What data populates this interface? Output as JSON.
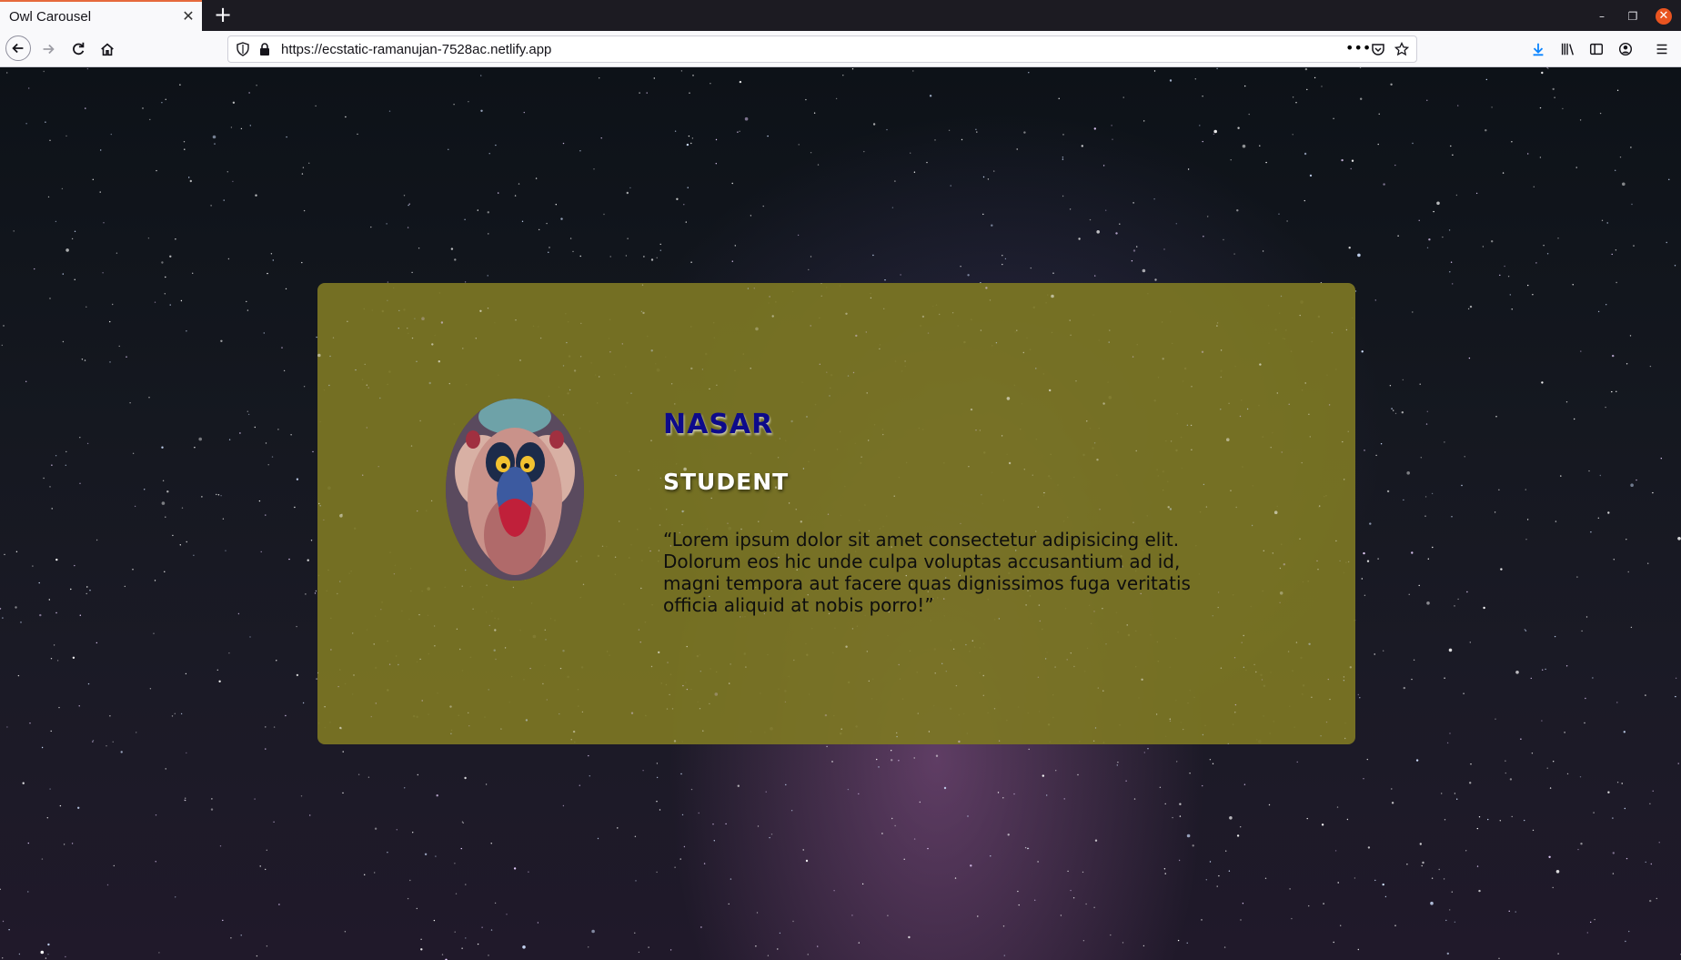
{
  "browser": {
    "tab_title": "Owl Carousel",
    "url": "https://ecstatic-ramanujan-7528ac.netlify.app",
    "icons": [
      "close-tab-icon",
      "new-tab-icon",
      "back-icon",
      "forward-icon",
      "reload-icon",
      "home-icon",
      "shield-icon",
      "lock-icon",
      "more-icon",
      "pocket-icon",
      "star-icon",
      "download-icon",
      "library-icon",
      "sidebar-icon",
      "account-icon",
      "menu-icon",
      "minimize-icon",
      "maximize-icon",
      "close-window-icon"
    ],
    "accent_color": "#e66a3c"
  },
  "card": {
    "name": "NASAR",
    "role": "STUDENT",
    "quote": "“Lorem ipsum dolor sit amet consectetur adipisicing elit. Dolorum eos hic unde culpa voluptas accusantium ad id, magni tempora aut facere quas dignissimos fuga veritatis officia aliquid at nobis porro!”",
    "background_color": "#7c7624",
    "name_color": "#0d0a8a",
    "role_color": "#ffffff"
  }
}
